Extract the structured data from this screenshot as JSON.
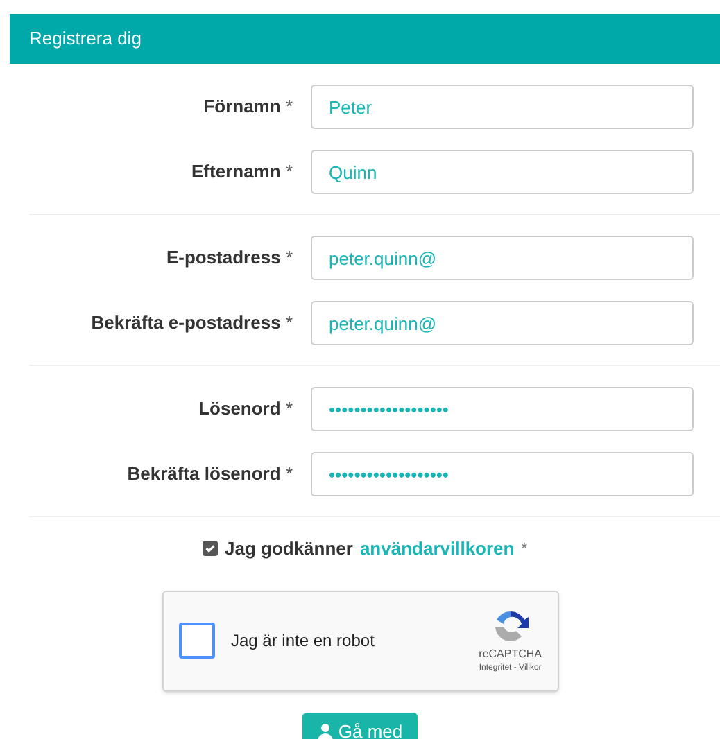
{
  "panel": {
    "title": "Registrera dig"
  },
  "field_groups": [
    {
      "fields": [
        {
          "label": "Förnamn",
          "required": "*",
          "value": "Peter"
        },
        {
          "label": "Efternamn",
          "required": "*",
          "value": "Quinn"
        }
      ]
    },
    {
      "fields": [
        {
          "label": "E-postadress",
          "required": "*",
          "value": "peter.quinn@"
        },
        {
          "label": "Bekräfta e-postadress",
          "required": "*",
          "value": "peter.quinn@"
        }
      ]
    },
    {
      "fields": [
        {
          "label": "Lösenord",
          "required": "*",
          "value": "•••••••••••••••••••"
        },
        {
          "label": "Bekräfta lösenord",
          "required": "*",
          "value": "•••••••••••••••••••"
        }
      ]
    }
  ],
  "terms": {
    "checked": true,
    "text": "Jag godkänner",
    "link": "användarvillkoren",
    "required": "*"
  },
  "captcha": {
    "checked": false,
    "label": "Jag är inte en robot",
    "brand": "reCAPTCHA",
    "links": "Integritet - Villkor"
  },
  "submit_button": {
    "label": "Gå med"
  }
}
